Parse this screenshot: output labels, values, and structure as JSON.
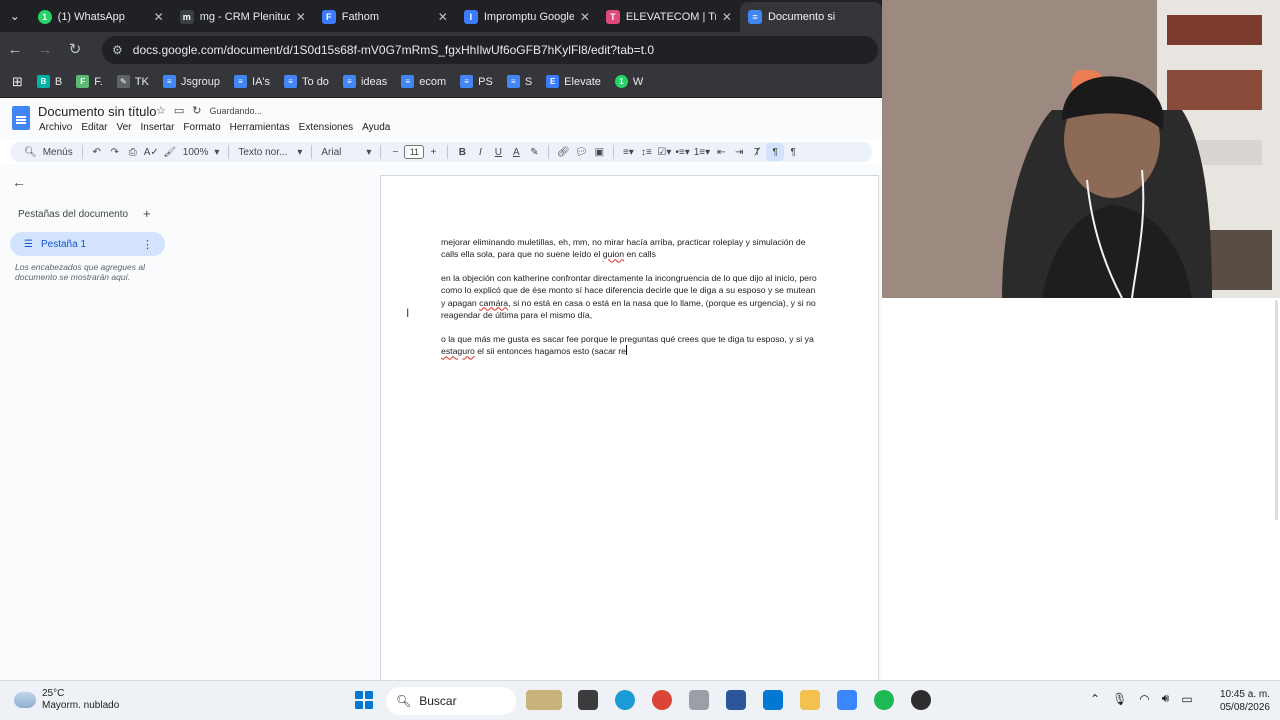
{
  "browser": {
    "tabs": [
      {
        "title": "(1) WhatsApp",
        "icon": "whatsapp-icon",
        "color": "#25d366"
      },
      {
        "title": "mg - CRM Plenitud S",
        "icon": "mg-icon",
        "color": "#3c4043"
      },
      {
        "title": "Fathom",
        "icon": "fathom-icon",
        "color": "#3c7bfd"
      },
      {
        "title": "Impromptu Google I",
        "icon": "impromptu-icon",
        "color": "#3c7bfd"
      },
      {
        "title": "ELEVATECOM | Trello",
        "icon": "trello-icon",
        "color": "#e04a7a"
      },
      {
        "title": "Documento si",
        "icon": "docs-icon",
        "color": "#4285f4"
      }
    ],
    "url": "docs.google.com/document/d/1S0d15s68f-mV0G7mRmS_fgxHhIlwUf6oGFB7hKylFl8/edit?tab=t.0",
    "bookmarks": [
      {
        "label": "B",
        "icon": "bookmark-b-icon",
        "color": "#00b3a4"
      },
      {
        "label": "F.",
        "icon": "bookmark-f-icon",
        "color": "#5bb974"
      },
      {
        "label": "TK",
        "icon": "bookmark-tk-icon",
        "color": "#5f6368"
      },
      {
        "label": "Jsgroup",
        "icon": "docs-icon",
        "color": "#4285f4"
      },
      {
        "label": "IA's",
        "icon": "docs-icon",
        "color": "#4285f4"
      },
      {
        "label": "To do",
        "icon": "docs-icon",
        "color": "#4285f4"
      },
      {
        "label": "ideas",
        "icon": "docs-icon",
        "color": "#4285f4"
      },
      {
        "label": "ecom",
        "icon": "docs-icon",
        "color": "#4285f4"
      },
      {
        "label": "PS",
        "icon": "docs-icon",
        "color": "#4285f4"
      },
      {
        "label": "S",
        "icon": "docs-icon",
        "color": "#4285f4"
      },
      {
        "label": "Elevate",
        "icon": "elevate-icon",
        "color": "#3c7bfd"
      },
      {
        "label": "W",
        "icon": "whatsapp-icon",
        "color": "#25d366"
      }
    ]
  },
  "docs": {
    "title": "Documento sin título",
    "status": "Guardando...",
    "menus": [
      "Archivo",
      "Editar",
      "Ver",
      "Insertar",
      "Formato",
      "Herramientas",
      "Extensiones",
      "Ayuda"
    ],
    "toolbar": {
      "menus_label": "Menús",
      "zoom": "100%",
      "style": "Texto nor...",
      "font": "Arial",
      "font_size": "11"
    },
    "sidebar": {
      "heading": "Pestañas del documento",
      "tab_label": "Pestaña 1",
      "hint": "Los encabezados que agregues al documento se mostrarán aquí."
    },
    "body": {
      "p1_a": "mejorar eliminando muletillas, eh, mm, no mirar hacía arriba, practicar roleplay y simulación de calls ella sola, para que no suene leído el ",
      "p1_err": "guion",
      "p1_b": " en calls",
      "p2_a": "en la objeción con katherine confrontar directamente la incongruencia de lo que dijo al inicio, pero como lo explicó que de ése monto sí hace diferencia decirle que le diga a su esposo y se mutean y apagan ",
      "p2_err": "camára",
      "p2_b": ", si no está en casa o está en la nasa que lo llame, (porque es urgencia), y si no reagendar de última para el mismo día,",
      "p3_a": "o la que más me gusta es sacar fee porque le preguntas qué crees que te diga tu esposo, y si ya ",
      "p3_err": "estaguro",
      "p3_b": " el sii entonces hagamos esto (sacar re"
    }
  },
  "taskbar": {
    "temperature": "25°C",
    "weather": "Mayorm. nublado",
    "search_placeholder": "Buscar",
    "time": "10:45 a. m.",
    "date": "05/08/2026"
  }
}
